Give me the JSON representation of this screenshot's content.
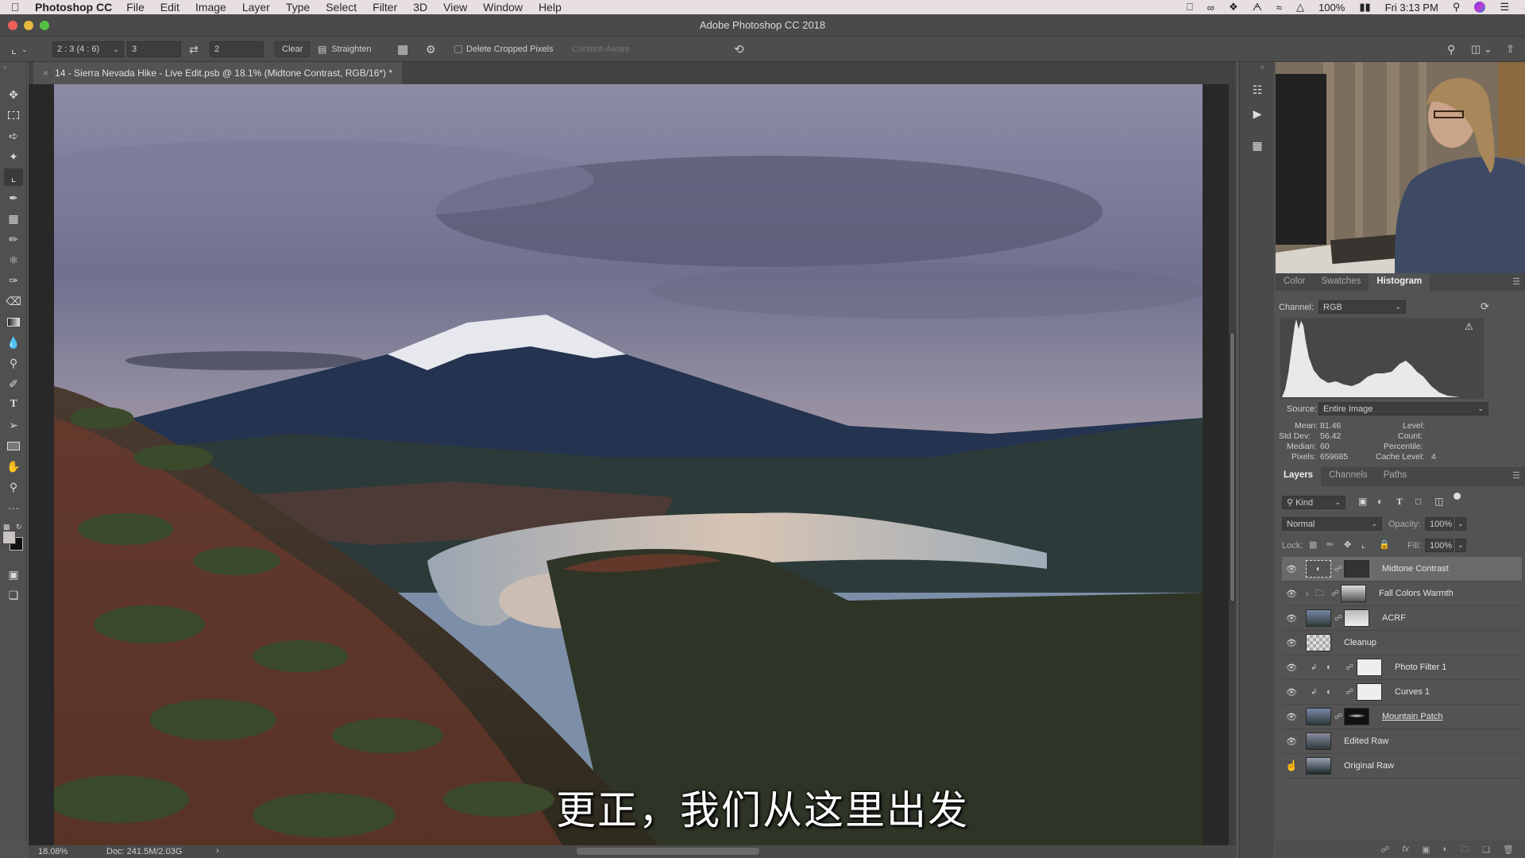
{
  "menubar": {
    "apple_icon": "apple-icon",
    "app_name": "Photoshop CC",
    "items": [
      "File",
      "Edit",
      "Image",
      "Layer",
      "Type",
      "Select",
      "Filter",
      "3D",
      "View",
      "Window",
      "Help"
    ],
    "status": {
      "battery": "100%",
      "clock": "Fri 3:13 PM",
      "icons": [
        "display-power-icon",
        "creative-cloud-icon",
        "dropbox-icon",
        "bluetooth-icon",
        "wifi-icon",
        "airplay-icon",
        "battery-icon",
        "spotlight-search-icon",
        "siri-icon",
        "notification-center-icon"
      ]
    }
  },
  "window": {
    "title": "Adobe Photoshop CC 2018"
  },
  "options_bar": {
    "ratio_preset": "2 : 3 (4 : 6)",
    "width_value": "3",
    "height_value": "2",
    "clear_label": "Clear",
    "straighten_label": "Straighten",
    "delete_cropped_label": "Delete Cropped Pixels",
    "delete_cropped_checked": false,
    "content_aware_label": "Content-Aware"
  },
  "document": {
    "tab_title": "14 - Sierra Nevada Hike - Live Edit.psb @ 18.1% (Midtone Contrast, RGB/16*) *",
    "zoom": "18.08%",
    "doc_size": "Doc: 241.5M/2.03G"
  },
  "tools": [
    "move",
    "marquee",
    "lasso",
    "magic-wand",
    "crop",
    "eyedropper",
    "healing-brush",
    "brush",
    "clone-stamp",
    "history-brush",
    "eraser",
    "gradient",
    "blur",
    "dodge",
    "pen",
    "type",
    "path-selection",
    "rectangle",
    "hand",
    "zoom",
    "more-tools"
  ],
  "colors": {
    "foreground": "#c9c3c2",
    "background": "#111111",
    "menubar_bg": "#e7dfe0",
    "panel_bg": "#535353"
  },
  "histogram_panel": {
    "tabs": [
      "Color",
      "Swatches",
      "Histogram"
    ],
    "active_tab": "Histogram",
    "channel_label": "Channel:",
    "channel_value": "RGB",
    "source_label": "Source:",
    "source_value": "Entire Image",
    "stats": {
      "mean_label": "Mean:",
      "mean": "81.46",
      "std_label": "Std Dev:",
      "std": "56.42",
      "median_label": "Median:",
      "median": "60",
      "pixels_label": "Pixels:",
      "pixels": "659685",
      "level_label": "Level:",
      "level": "",
      "count_label": "Count:",
      "count": "",
      "percentile_label": "Percentile:",
      "percentile": "",
      "cache_label": "Cache Level:",
      "cache": "4"
    }
  },
  "layers_panel": {
    "tabs": [
      "Layers",
      "Channels",
      "Paths"
    ],
    "active_tab": "Layers",
    "filter_kind": "Kind",
    "blend_mode": "Normal",
    "opacity_label": "Opacity:",
    "opacity": "100%",
    "lock_label": "Lock:",
    "fill_label": "Fill:",
    "fill": "100%",
    "layers": [
      {
        "name": "Midtone Contrast",
        "type": "adjustment-smart",
        "selected": true,
        "visible": true
      },
      {
        "name": "Fall Colors Warmth",
        "type": "group",
        "selected": false,
        "visible": true
      },
      {
        "name": "ACRF",
        "type": "image-mask",
        "selected": false,
        "visible": true
      },
      {
        "name": "Cleanup",
        "type": "empty",
        "selected": false,
        "visible": true
      },
      {
        "name": "Photo Filter 1",
        "type": "adjustment-clipped",
        "selected": false,
        "visible": true
      },
      {
        "name": "Curves 1",
        "type": "adjustment-clipped",
        "selected": false,
        "visible": true
      },
      {
        "name": "Mountain Patch",
        "type": "image-mask",
        "selected": false,
        "visible": true
      },
      {
        "name": "Edited Raw",
        "type": "image",
        "selected": false,
        "visible": true
      },
      {
        "name": "Original Raw",
        "type": "image",
        "selected": false,
        "visible": false
      }
    ]
  },
  "subtitle": "更正，我们从这里出发"
}
